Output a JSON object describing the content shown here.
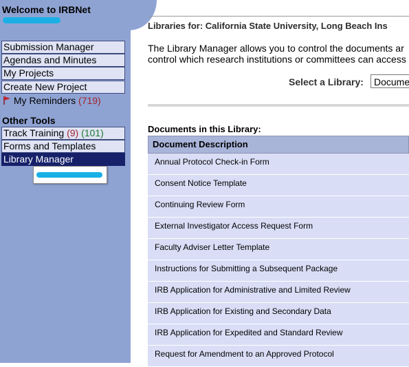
{
  "sidebar": {
    "welcome": "Welcome to IRBNet",
    "nav": [
      "Submission Manager",
      "Agendas and Minutes",
      "My Projects",
      "Create New Project"
    ],
    "reminders": {
      "label": "My Reminders",
      "count": "(719)"
    },
    "other_tools_title": "Other Tools",
    "track_training": {
      "label": "Track Training",
      "count1": "(9)",
      "count2": "(101)"
    },
    "forms_templates": "Forms and Templates",
    "library_manager": "Library Manager",
    "colors": {
      "sidebar_bg": "#8fa3d3",
      "active_bg": "#16216a",
      "count_red": "#a3242d",
      "count_green": "#1c7a2f"
    }
  },
  "main": {
    "libraries_for": "Libraries for: California State University, Long Beach Ins",
    "intro_line1": "The Library Manager allows you to control the documents ar",
    "intro_line2": "control which research institutions or committees can access",
    "select_label": "Select a Library:",
    "select_value": "Docume",
    "docs_title": "Documents in this Library:",
    "table": {
      "header": "Document Description",
      "rows": [
        "Annual Protocol Check-in Form",
        "Consent Notice Template",
        "Continuing Review Form",
        "External Investigator Access Request Form",
        "Faculty Adviser Letter Template",
        "Instructions for Submitting a Subsequent Package",
        "IRB Application for Administrative and Limited Review",
        "IRB Application for Existing and Secondary Data",
        "IRB Application for Expedited and Standard Review",
        "Request for Amendment to an Approved Protocol"
      ]
    }
  },
  "icons": {
    "reminder": "flag-icon"
  }
}
